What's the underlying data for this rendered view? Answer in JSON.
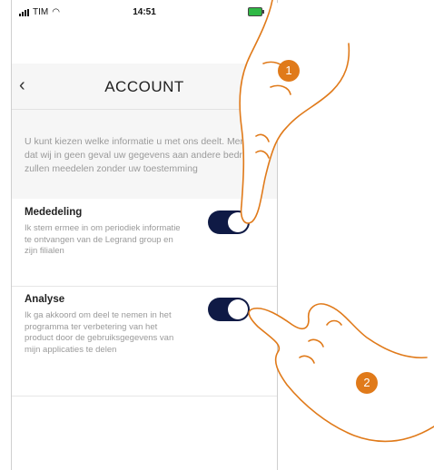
{
  "status": {
    "carrier": "TIM",
    "time": "14:51"
  },
  "header": {
    "title": "ACCOUNT",
    "back_icon": "chevron-left-icon"
  },
  "info": {
    "text": "U kunt kiezen welke informatie u met ons deelt. Merk op dat wij in geen geval uw gegevens aan andere bedrijven zullen meedelen zonder uw toestemming"
  },
  "settings": [
    {
      "label": "Mededeling",
      "description": "Ik stem ermee in om periodiek informatie te ontvangen van de Legrand group en zijn filialen",
      "enabled": true
    },
    {
      "label": "Analyse",
      "description": "Ik ga akkoord om deel te nemen in het programma ter verbetering van het product door de gebruiksgegevens van mijn applicaties te delen",
      "enabled": true
    }
  ],
  "callouts": [
    {
      "number": "1"
    },
    {
      "number": "2"
    }
  ],
  "colors": {
    "toggle_on": "#0f1a45",
    "badge": "#e07a1a",
    "hand_outline": "#e07a1a"
  }
}
